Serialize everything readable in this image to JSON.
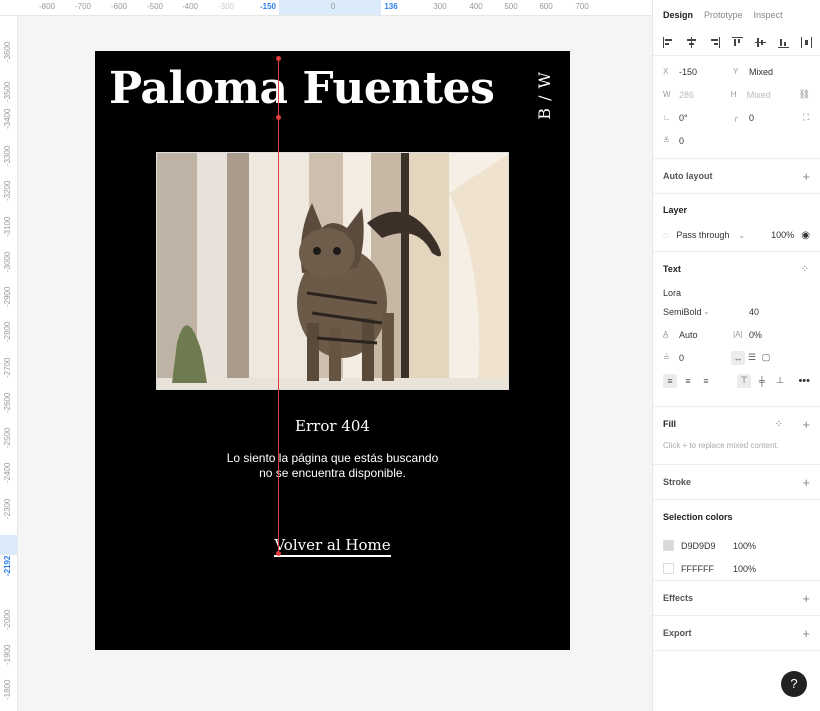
{
  "ruler": {
    "top_labels": [
      "-800",
      "-700",
      "-600",
      "-500",
      "-400",
      "-300",
      "-150",
      "0",
      "136",
      "300",
      "400",
      "500",
      "600",
      "700"
    ],
    "top_selected": [
      "-150",
      "136"
    ],
    "left_labels": [
      "-3600",
      "-3500",
      "-3400",
      "-3300",
      "-3200",
      "-3100",
      "-3000",
      "-2900",
      "-2800",
      "-2700",
      "-2600",
      "-2500",
      "-2400",
      "-2300",
      "-2192",
      "-2000",
      "-1900",
      "-1800"
    ],
    "left_selected": "-2192"
  },
  "canvas": {
    "title": "Paloma Fuentes",
    "vertical_text": "B / W",
    "error_title": "Error 404",
    "message_line1": "Lo siento la página que estás buscando",
    "message_line2": "no se encuentra disponible.",
    "home_link": "Volver al Home"
  },
  "panel": {
    "tabs": [
      "Design",
      "Prototype",
      "Inspect"
    ],
    "position": {
      "x_label": "X",
      "x_value": "-150",
      "y_label": "Y",
      "y_value": "Mixed",
      "w_label": "W",
      "w_value": "286",
      "h_label": "H",
      "h_value": "Mixed",
      "rotation": "0°",
      "radius": "0",
      "spacing": "0"
    },
    "auto_layout": "Auto layout",
    "layer": {
      "title": "Layer",
      "blend": "Pass through",
      "opacity": "100%"
    },
    "text": {
      "title": "Text",
      "font": "Lora",
      "weight": "SemiBold",
      "size": "40",
      "line_height": "Auto",
      "letter_spacing": "0%",
      "paragraph_spacing": "0"
    },
    "fill": {
      "title": "Fill",
      "hint": "Click + to replace mixed content."
    },
    "stroke": "Stroke",
    "selection_colors": {
      "title": "Selection colors",
      "colors": [
        {
          "hex": "D9D9D9",
          "opacity": "100%",
          "swatch": "#D9D9D9"
        },
        {
          "hex": "FFFFFF",
          "opacity": "100%",
          "swatch": "#FFFFFF"
        }
      ]
    },
    "effects": "Effects",
    "export": "Export",
    "help": "?"
  }
}
